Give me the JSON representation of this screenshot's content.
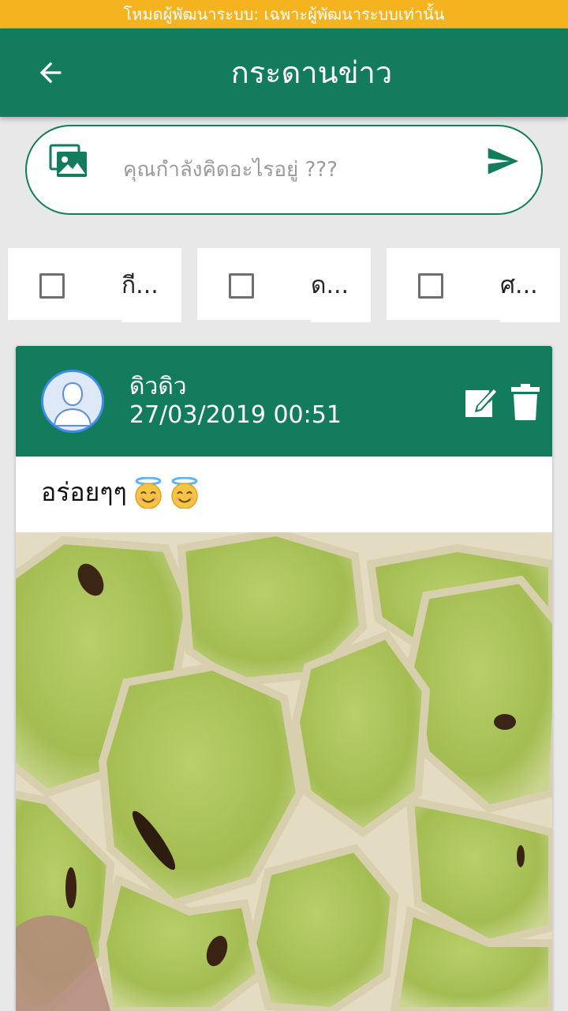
{
  "dev_banner": {
    "text": "โหมดผู้พัฒนาระบบ: เฉพาะผู้พัฒนาระบบเท่านั้น",
    "color": "#f5b41f"
  },
  "app_bar": {
    "title": "กระดานข่าว",
    "back_icon": "arrow-left-icon",
    "color": "#127c5c"
  },
  "compose": {
    "placeholder": "คุณกำลังคิดอะไรอยู่ ???",
    "value": "",
    "image_icon": "image-gallery-icon",
    "send_icon": "send-icon"
  },
  "categories": [
    {
      "label": "กี...",
      "checked": false
    },
    {
      "label": "ด...",
      "checked": false
    },
    {
      "label": "ศ...",
      "checked": false
    }
  ],
  "post": {
    "author": "ดิวดิว",
    "timestamp": "27/03/2019 00:51",
    "text": "อร่อยๆๆ",
    "emoji": [
      "smiling-face-with-halo",
      "smiling-face-with-halo"
    ],
    "avatar_icon": "default-user-avatar",
    "edit_icon": "edit-icon",
    "delete_icon": "trash-icon"
  }
}
